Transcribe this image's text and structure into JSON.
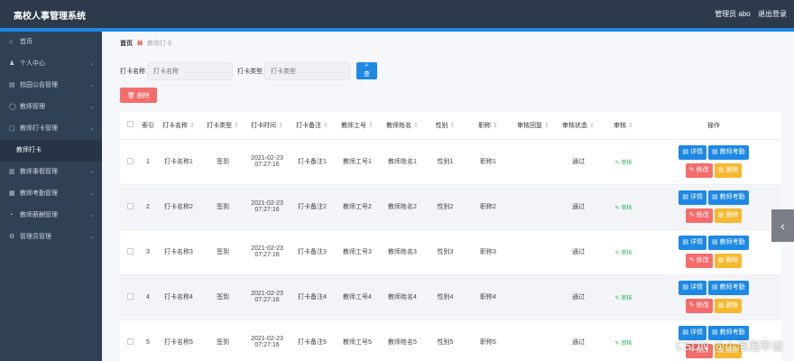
{
  "header": {
    "title": "高校人事管理系统",
    "role_label": "管理员 abo",
    "logout_label": "退出登录"
  },
  "sidebar": {
    "items": [
      {
        "label": "首页",
        "icon": "home-icon",
        "has_chevron": false,
        "active": false
      },
      {
        "label": "个人中心",
        "icon": "user-icon",
        "has_chevron": true,
        "active": false
      },
      {
        "label": "校园公告管理",
        "icon": "notice-icon",
        "has_chevron": true,
        "active": false
      },
      {
        "label": "教师管理",
        "icon": "teacher-icon",
        "has_chevron": true,
        "active": false
      },
      {
        "label": "教师打卡管理",
        "icon": "checkin-icon",
        "has_chevron": true,
        "active": false
      },
      {
        "label": "教师打卡",
        "icon": "",
        "has_chevron": false,
        "active": true,
        "sub": true
      },
      {
        "label": "教师事假管理",
        "icon": "leave-icon",
        "has_chevron": true,
        "active": false
      },
      {
        "label": "教师考勤管理",
        "icon": "attendance-icon",
        "has_chevron": true,
        "active": false
      },
      {
        "label": "教师薪酬管理",
        "icon": "salary-icon",
        "has_chevron": true,
        "active": false
      },
      {
        "label": "管理员管理",
        "icon": "admin-icon",
        "has_chevron": true,
        "active": false
      }
    ]
  },
  "breadcrumb": {
    "home": "首页",
    "current": "教师打卡"
  },
  "filters": {
    "name_label": "打卡名称",
    "name_placeholder": "打卡名称",
    "type_label": "打卡类型",
    "type_placeholder": "打卡类型",
    "search_label": "查询"
  },
  "toolbar": {
    "delete_label": "删除"
  },
  "table": {
    "headers": {
      "index": "索引",
      "name": "打卡名称",
      "type": "打卡类型",
      "time": "打卡时间",
      "note": "打卡备注",
      "teacher_no": "教师工号",
      "teacher_name": "教师姓名",
      "gender": "性别",
      "title": "职称",
      "reply": "审核回复",
      "status": "审核状态",
      "audit": "审核",
      "actions": "操作"
    },
    "action_labels": {
      "detail": "详情",
      "attendance": "教师考勤",
      "edit": "修改",
      "delete": "删除",
      "audit": "审核"
    },
    "rows": [
      {
        "index": "1",
        "name": "打卡名称1",
        "type": "签到",
        "date": "2021-02-23",
        "clock": "07:27:16",
        "note": "打卡备注1",
        "teacher_no": "教师工号1",
        "teacher_name": "教师姓名1",
        "gender": "性别1",
        "title": "职称1",
        "reply": "",
        "status": "通过"
      },
      {
        "index": "2",
        "name": "打卡名称2",
        "type": "签到",
        "date": "2021-02-23",
        "clock": "07:27:16",
        "note": "打卡备注2",
        "teacher_no": "教师工号2",
        "teacher_name": "教师姓名2",
        "gender": "性别2",
        "title": "职称2",
        "reply": "",
        "status": "通过"
      },
      {
        "index": "3",
        "name": "打卡名称3",
        "type": "签到",
        "date": "2021-02-23",
        "clock": "07:27:16",
        "note": "打卡备注3",
        "teacher_no": "教师工号3",
        "teacher_name": "教师姓名3",
        "gender": "性别3",
        "title": "职称3",
        "reply": "",
        "status": "通过"
      },
      {
        "index": "4",
        "name": "打卡名称4",
        "type": "签到",
        "date": "2021-02-23",
        "clock": "07:27:16",
        "note": "打卡备注4",
        "teacher_no": "教师工号4",
        "teacher_name": "教师姓名4",
        "gender": "性别4",
        "title": "职称4",
        "reply": "",
        "status": "通过"
      },
      {
        "index": "5",
        "name": "打卡名称5",
        "type": "签到",
        "date": "2021-02-23",
        "clock": "07:27:16",
        "note": "打卡备注5",
        "teacher_no": "教师工号5",
        "teacher_name": "教师姓名5",
        "gender": "性别5",
        "title": "职称5",
        "reply": "",
        "status": "通过"
      }
    ]
  },
  "watermark": "CSDN @小泡泡毕设",
  "colors": {
    "topbar": "#2d3a4b",
    "sidebar": "#304156",
    "accent": "#1e88e5",
    "danger": "#f56c6c",
    "warning": "#f5b82e",
    "success": "#27ae60"
  }
}
